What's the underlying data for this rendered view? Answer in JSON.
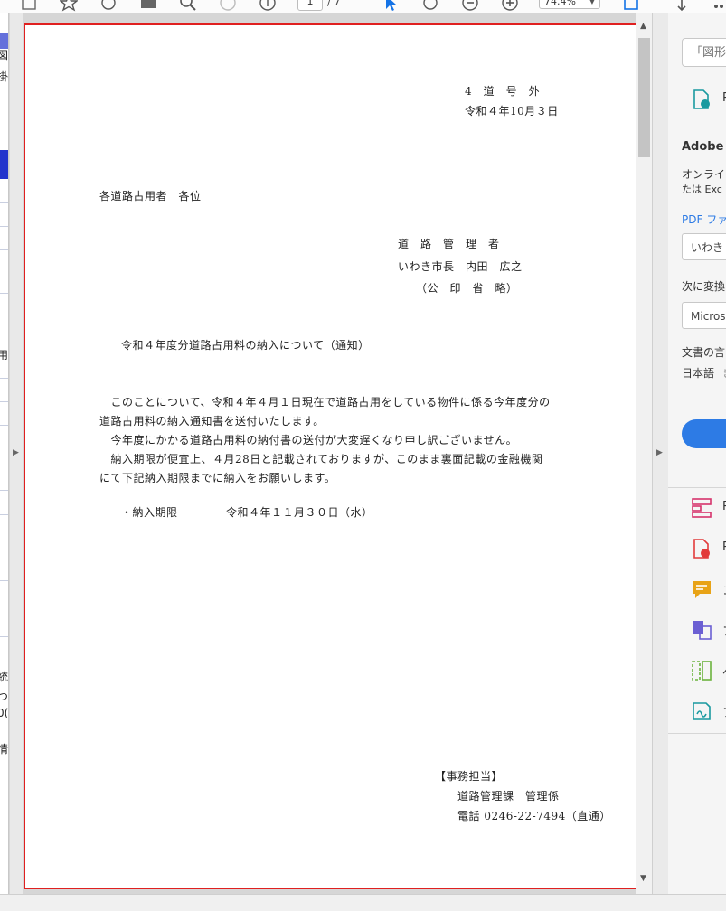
{
  "toolbar": {
    "page_current": "1",
    "page_total": "/ 7",
    "zoom": "74.4%"
  },
  "left_strip": {
    "chars": [
      "図",
      "掛",
      "用",
      "統",
      "つ",
      "0(",
      "情"
    ]
  },
  "document": {
    "doc_number": "4　道　号　外",
    "doc_date": "令和４年10月３日",
    "addressee": "各道路占用者　各位",
    "issuer_title": "道　路　管　理　者",
    "issuer_name": "いわき市長　内田　広之",
    "seal_note": "（公　印　省　略）",
    "subject": "令和４年度分道路占用料の納入について（通知）",
    "body_lines": [
      "　このことについて、令和４年４月１日現在で道路占用をしている物件に係る今年度分の",
      "道路占用料の納入通知書を送付いたします。",
      "　今年度にかかる道路占用料の納付書の送付が大変遅くなり申し訳ございません。",
      "　納入期限が便宜上、４月28日と記載されておりますが、このまま裏面記載の金融機関",
      "にて下記納入期限までに納入をお願いします。"
    ],
    "deadline_label": "・納入期限",
    "deadline_value": "令和４年１１月３０日（水）",
    "contact_heading": "【事務担当】",
    "contact_dept": "道路管理課　管理係",
    "contact_phone": "電話 0246-22-7494（直通）"
  },
  "right_pane": {
    "search_placeholder": "「図形",
    "top_tool_label": "P",
    "section_title": "Adobe I",
    "desc_line1": "オンライ",
    "desc_line2": "たは Exc",
    "pdf_label": "PDF ファ",
    "file_field": "いわき",
    "convert_label": "次に変換",
    "format_field": "Micros",
    "lang_label": "文書の言",
    "lang_value": "日本語",
    "lang_extra": "き",
    "tools": [
      {
        "label": "P",
        "icon": "organize-pages-icon",
        "color": "#d6336c"
      },
      {
        "label": "P",
        "icon": "create-pdf-icon",
        "color": "#e23b3b"
      },
      {
        "label": "コ",
        "icon": "comment-icon",
        "color": "#e8a317"
      },
      {
        "label": "フ",
        "icon": "combine-files-icon",
        "color": "#6b5fd3"
      },
      {
        "label": "ペ",
        "icon": "export-pages-icon",
        "color": "#6cb33e"
      },
      {
        "label": "フ",
        "icon": "fill-sign-icon",
        "color": "#1a9aa0"
      }
    ]
  },
  "colors": {
    "page_border": "#e02020",
    "accent_blue": "#2d7be5",
    "toolbar_blue": "#1473e6"
  }
}
